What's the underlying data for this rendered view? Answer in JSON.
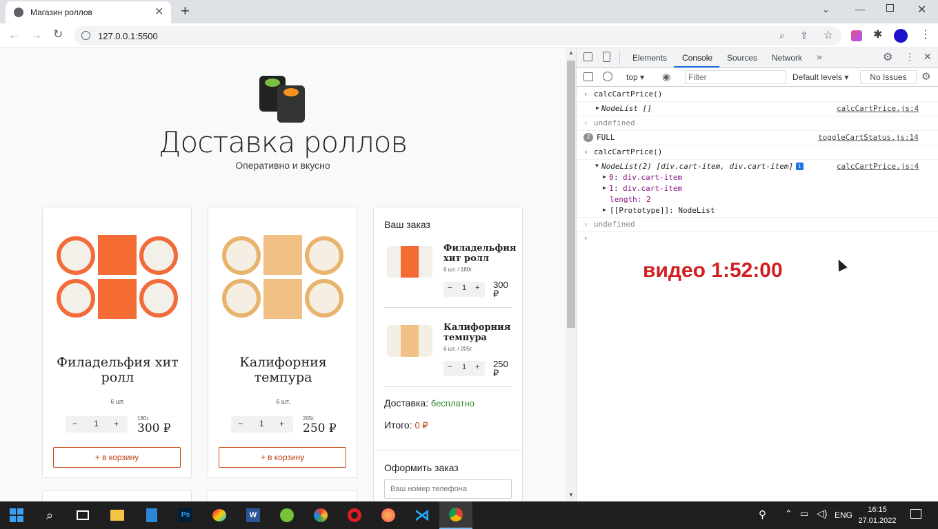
{
  "browser": {
    "tab_title": "Магазин роллов",
    "url": "127.0.0.1:5500"
  },
  "site": {
    "title": "Доставка роллов",
    "subtitle": "Оперативно и вкусно",
    "products": [
      {
        "name": "Филадельфия хит ролл",
        "count": "6 шт.",
        "qty": "1",
        "weight": "180г.",
        "price": "300 ₽",
        "add": "+ в корзину"
      },
      {
        "name": "Калифорния темпура",
        "count": "6 шт.",
        "qty": "1",
        "weight": "205г.",
        "price": "250 ₽",
        "add": "+ в корзину"
      }
    ],
    "cart": {
      "title": "Ваш заказ",
      "items": [
        {
          "name": "Филадельфия хит ролл",
          "info": "6 шт. / 180г.",
          "qty": "1",
          "price": "300 ₽"
        },
        {
          "name": "Калифорния темпура",
          "info": "6 шт. / 205г.",
          "qty": "1",
          "price": "250 ₽"
        }
      ],
      "delivery_label": "Доставка:",
      "delivery_value": "бесплатно",
      "total_label": "Итого:",
      "total_value": "0 ₽",
      "order_title": "Оформить заказ",
      "phone_placeholder": "Ваш номер телефона"
    }
  },
  "devtools": {
    "tabs": [
      "Elements",
      "Console",
      "Sources",
      "Network"
    ],
    "active_tab": "Console",
    "context": "top",
    "filter_placeholder": "Filter",
    "levels": "Default levels",
    "issues": "No Issues",
    "lines": {
      "l1": "calcCartPrice()",
      "l2": "NodeList []",
      "l2_src": "calcCartPrice.js:4",
      "l3": "undefined",
      "l4_count": "2",
      "l4": "FULL",
      "l4_src": "toggleCartStatus.js:14",
      "l5": "calcCartPrice()",
      "l6": "NodeList(2) [div.cart-item, div.cart-item]",
      "l6_src": "calcCartPrice.js:4",
      "l7_key": "0",
      "l7_val": "div.cart-item",
      "l8_key": "1",
      "l8_val": "div.cart-item",
      "l9": "length: 2",
      "l10": "[[Prototype]]: NodeList",
      "l11": "undefined"
    },
    "overlay": "видео 1:52:00"
  },
  "taskbar": {
    "lang": "ENG",
    "time": "16:15",
    "date": "27.01.2022"
  },
  "colors": {
    "accent": "#c2410c",
    "green": "#2e8b2e",
    "overlay_red": "#d21f1f"
  }
}
